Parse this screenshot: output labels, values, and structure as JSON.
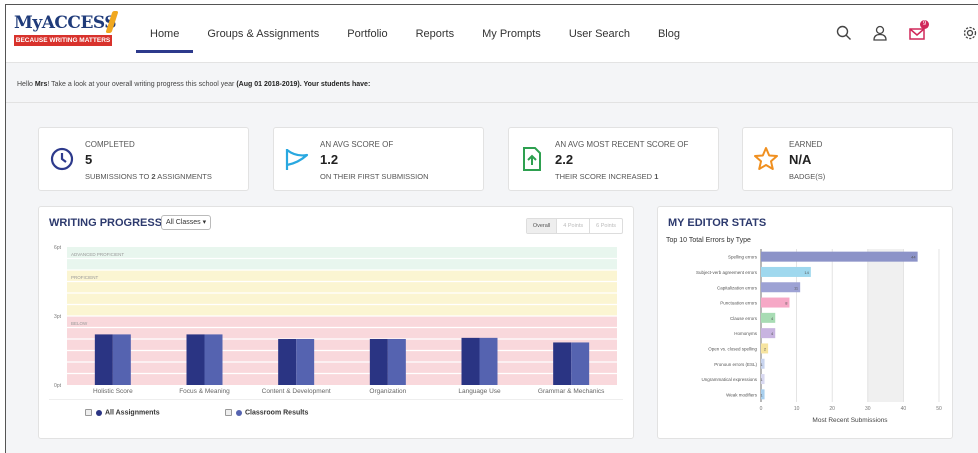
{
  "logo": {
    "text": "MyACCESS",
    "tagline": "BECAUSE WRITING MATTERS"
  },
  "nav": [
    {
      "label": "Home",
      "active": true
    },
    {
      "label": "Groups & Assignments"
    },
    {
      "label": "Portfolio"
    },
    {
      "label": "Reports"
    },
    {
      "label": "My Prompts"
    },
    {
      "label": "User Search"
    },
    {
      "label": "Blog"
    }
  ],
  "header_icons": [
    "search-icon",
    "user-icon",
    "mail-icon",
    "gear-icon"
  ],
  "notification_count": "9",
  "greeting": {
    "prefix": "Hello ",
    "name": "Mrs",
    "middle": "! Take a look at your overall writing progress this school year ",
    "period": "(Aug 01 2018-2019). Your students have:"
  },
  "cards": [
    {
      "caption": "COMPLETED",
      "value": "5",
      "sub_prefix": "SUBMISSIONS TO ",
      "sub_bold": "2",
      "sub_suffix": " ASSIGNMENTS",
      "icon": "clock-icon"
    },
    {
      "caption": "AN AVG SCORE OF",
      "value": "1.2",
      "sub_prefix": "ON THEIR FIRST SUBMISSION",
      "sub_bold": "",
      "sub_suffix": "",
      "icon": "flag-icon"
    },
    {
      "caption": "AN AVG MOST RECENT SCORE OF",
      "value": "2.2",
      "sub_prefix": "THEIR SCORE INCREASED ",
      "sub_bold": "1",
      "sub_suffix": "",
      "icon": "score-up-icon"
    },
    {
      "caption": "EARNED",
      "value": "N/A",
      "sub_prefix": "BADGE(S)",
      "sub_bold": "",
      "sub_suffix": "",
      "icon": "star-icon"
    }
  ],
  "writing_progress": {
    "title": "WRITING PROGRESS",
    "dropdown": "All Classes",
    "toggles": [
      "Overall",
      "4 Points",
      "6 Points"
    ],
    "legend": [
      "All Assignments",
      "Classroom Results"
    ]
  },
  "editor_stats": {
    "title": "MY EDITOR STATS",
    "subtitle": "Top 10 Total Errors by Type"
  },
  "colors": {
    "accent": "#2d3a8c",
    "series_a": "#2a3483",
    "series_b": "#5563b0",
    "band_advanced": "#e8f6ee",
    "band_proficient": "#fbf5d2",
    "band_below": "#f9d8dc"
  },
  "chart_data": [
    {
      "type": "bar",
      "title": "WRITING PROGRESS",
      "categories": [
        "Holistic Score",
        "Focus & Meaning",
        "Content & Development",
        "Organization",
        "Language Use",
        "Grammar & Mechanics"
      ],
      "series": [
        {
          "name": "All Assignments",
          "values": [
            2.2,
            2.2,
            2.0,
            2.0,
            2.05,
            1.85
          ]
        },
        {
          "name": "Classroom Results",
          "values": [
            2.2,
            2.2,
            2.0,
            2.0,
            2.05,
            1.85
          ]
        }
      ],
      "y_ticks": [
        "0pt",
        "3pt",
        "6pt"
      ],
      "ylim": [
        0,
        6
      ],
      "bands": [
        {
          "label": "ADVANCED PROFICIENT",
          "from": 5,
          "to": 6
        },
        {
          "label": "PROFICIENT",
          "from": 3,
          "to": 5
        },
        {
          "label": "BELOW",
          "from": 0,
          "to": 3
        }
      ],
      "grid": true,
      "legend": "bottom"
    },
    {
      "type": "bar",
      "orientation": "horizontal",
      "subtitle": "Top 10 Total Errors by Type",
      "categories": [
        "Spelling errors",
        "Subject-verb agreement errors",
        "Capitalization errors",
        "Punctuation errors",
        "Clause errors",
        "Homonyms",
        "Open vs. closed spelling",
        "Pronoun errors (ESL)",
        "Ungrammatical expressions",
        "Weak modifiers"
      ],
      "values": [
        44,
        14,
        11,
        8,
        4,
        4,
        2,
        1,
        1,
        1
      ],
      "bar_colors": [
        "#8c93c8",
        "#9fd8ee",
        "#9da2d4",
        "#f6a8c6",
        "#a8dcb4",
        "#c8b4e0",
        "#f6e4a0",
        "#c8d4ee",
        "#d8d8f0",
        "#a8cfee"
      ],
      "xlabel": "Most Recent Submissions",
      "xlim": [
        0,
        50
      ],
      "x_ticks": [
        0,
        10,
        20,
        30,
        40,
        50
      ],
      "grid": true
    }
  ]
}
